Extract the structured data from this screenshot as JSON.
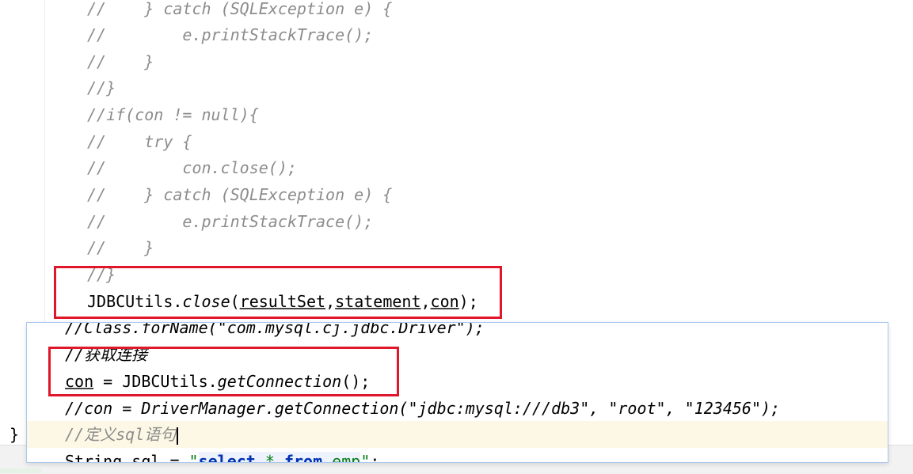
{
  "editor": {
    "lines": [
      {
        "prefix": "//    } catch (SQLException e) {"
      },
      {
        "prefix": "//        e.printStackTrace();"
      },
      {
        "prefix": "//    }"
      },
      {
        "prefix": "//}"
      },
      {
        "prefix": "//if(con != null){"
      },
      {
        "prefix": "//    try {"
      },
      {
        "prefix": "//        con.close();"
      },
      {
        "prefix": "//    } catch (SQLException e) {"
      },
      {
        "prefix": "//        e.printStackTrace();"
      },
      {
        "prefix": "//    }"
      },
      {
        "prefix": "//}"
      }
    ],
    "close_call": {
      "cls": "JDBCUtils.",
      "method": "close",
      "open": "(",
      "arg1": "resultSet",
      "comma1": ",",
      "arg2": "statement",
      "comma2": ",",
      "arg3": "con",
      "tail": ");"
    },
    "closing_brace": "}"
  },
  "popup": {
    "line1": "//Class.forName(\"com.mysql.cj.jdbc.Driver\");",
    "line2": "//获取连接",
    "line3": {
      "var": "con",
      "mid": " = JDBCUtils.",
      "method": "getConnection",
      "tail": "();"
    },
    "line4": "//con = DriverManager.getConnection(\"jdbc:mysql:///db3\", \"root\", \"123456\");",
    "line5": "//定义sql语句",
    "line6": {
      "start": "String sql = ",
      "q1": "\"",
      "kw1": "select",
      "star": " * ",
      "kw2": "from",
      "rest": " emp",
      "q2": "\"",
      "end": ";"
    }
  },
  "colors": {
    "highlight_box": "#e0162b",
    "popup_border": "#a9c8ef",
    "current_line": "#fcf8e5",
    "comment": "#8c8c8c",
    "string": "#067d17",
    "keyword": "#0033b3"
  }
}
